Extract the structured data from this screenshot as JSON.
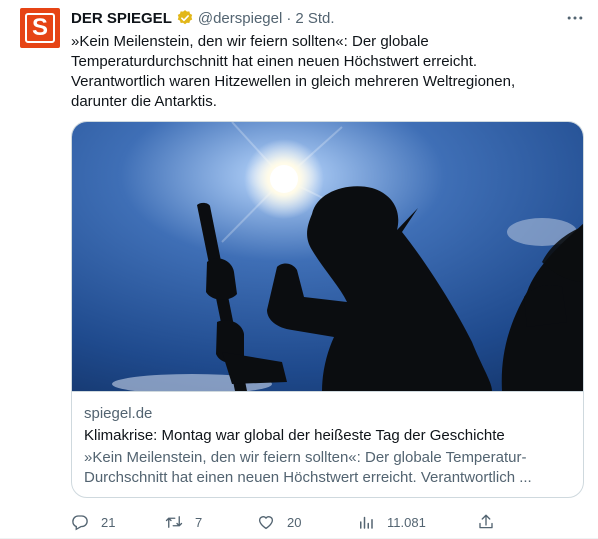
{
  "author": {
    "name": "DER SPIEGEL",
    "handle": "@derspiegel",
    "separator": "·",
    "time": "2 Std.",
    "avatar_letter": "S",
    "avatar_color": "#e64415",
    "verified_color": "#e2b719"
  },
  "tweet": {
    "lines": [
      "»Kein Meilenstein, den wir feiern sollten«: Der globale",
      "Temperaturdurchschnitt hat einen neuen Höchstwert erreicht.",
      "Verantwortlich waren Hitzewellen in gleich mehreren Weltregionen,",
      "darunter die Antarktis."
    ]
  },
  "card": {
    "domain": "spiegel.de",
    "title": "Klimakrise: Montag war global der heißeste Tag der Geschichte",
    "description": "»Kein Meilenstein, den wir feiern sollten«: Der globale Temperatur-Durchschnitt hat einen neuen Höchstwert erreicht. Verantwortlich ..."
  },
  "actions": {
    "replies": "21",
    "retweets": "7",
    "likes": "20",
    "views": "11.081"
  },
  "icons": {
    "more": "more-dots-icon",
    "reply": "reply-icon",
    "retweet": "retweet-icon",
    "like": "heart-icon",
    "views": "views-icon",
    "share": "share-icon"
  }
}
